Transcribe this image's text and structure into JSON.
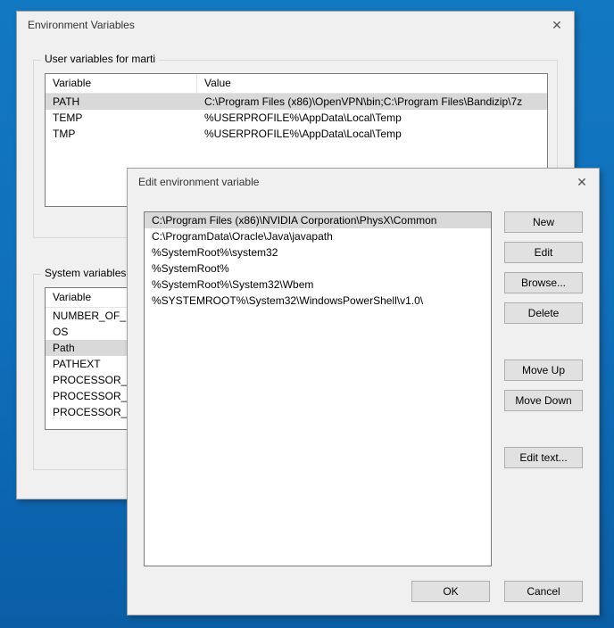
{
  "envvars": {
    "title": "Environment Variables",
    "user_group_label": "User variables for marti",
    "sys_group_label": "System variables",
    "columns": {
      "var": "Variable",
      "val": "Value"
    },
    "user_vars": [
      {
        "name": "PATH",
        "value": "C:\\Program Files (x86)\\OpenVPN\\bin;C:\\Program Files\\Bandizip\\7z",
        "selected": true
      },
      {
        "name": "TEMP",
        "value": "%USERPROFILE%\\AppData\\Local\\Temp",
        "selected": false
      },
      {
        "name": "TMP",
        "value": "%USERPROFILE%\\AppData\\Local\\Temp",
        "selected": false
      }
    ],
    "sys_vars": [
      {
        "name": "NUMBER_OF_PR",
        "selected": false
      },
      {
        "name": "OS",
        "selected": false
      },
      {
        "name": "Path",
        "selected": true
      },
      {
        "name": "PATHEXT",
        "selected": false
      },
      {
        "name": "PROCESSOR_AR",
        "selected": false
      },
      {
        "name": "PROCESSOR_IDE",
        "selected": false
      },
      {
        "name": "PROCESSOR_LEV",
        "selected": false
      }
    ]
  },
  "editlist": {
    "title": "Edit environment variable",
    "entries": [
      "C:\\Program Files (x86)\\NVIDIA Corporation\\PhysX\\Common",
      "C:\\ProgramData\\Oracle\\Java\\javapath",
      "%SystemRoot%\\system32",
      "%SystemRoot%",
      "%SystemRoot%\\System32\\Wbem",
      "%SYSTEMROOT%\\System32\\WindowsPowerShell\\v1.0\\"
    ],
    "selected_index": 0,
    "buttons": {
      "new": "New",
      "edit": "Edit",
      "browse": "Browse...",
      "delete": "Delete",
      "moveup": "Move Up",
      "movedown": "Move Down",
      "edittext": "Edit text...",
      "ok": "OK",
      "cancel": "Cancel"
    }
  }
}
